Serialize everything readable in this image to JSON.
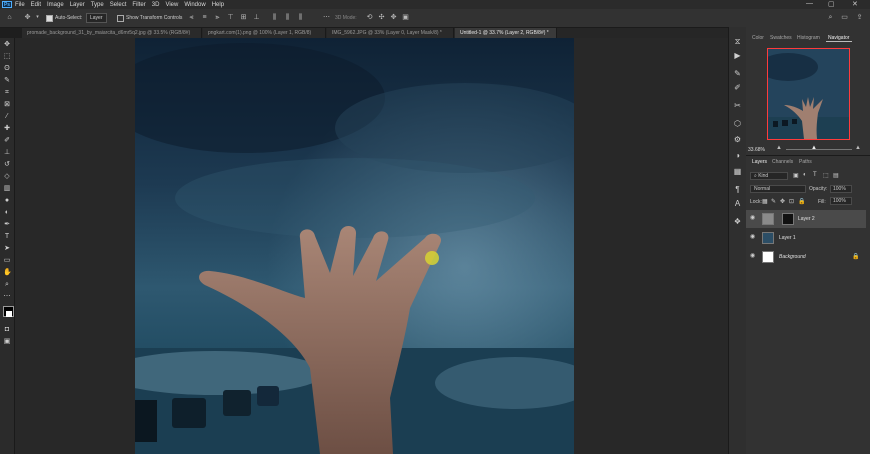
{
  "menubar": {
    "logo": "Ps",
    "items": [
      "File",
      "Edit",
      "Image",
      "Layer",
      "Type",
      "Select",
      "Filter",
      "3D",
      "View",
      "Window",
      "Help"
    ]
  },
  "options": {
    "auto_select_label": "Auto-Select:",
    "layer_select": "Layer",
    "transform_controls": "Show Transform Controls",
    "mode_3d": "3D Mode:"
  },
  "tabs": [
    "promade_background_31_by_maiarcita_d6mr5q2.jpg @ 33.5% (RGB/8#)",
    "pngkart.com(1).png @ 100% (Layer 1, RGB/8)",
    "IMG_5962.JPG @ 33% (Layer 0, Layer Mask/8) *",
    "Untitled-1 @ 33.7% (Layer 2, RGB/8#) *"
  ],
  "panel_tabs_top": [
    "Color",
    "Swatches",
    "Histogram",
    "Navigator"
  ],
  "navigator": {
    "zoom": "33.68%"
  },
  "panel_tabs_layers": [
    "Layers",
    "Channels",
    "Paths"
  ],
  "layers_panel": {
    "kind_filter": "Kind",
    "blend_mode": "Normal",
    "opacity_label": "Opacity:",
    "opacity_value": "100%",
    "lock_label": "Lock:",
    "fill_label": "Fill:",
    "fill_value": "100%"
  },
  "layers": [
    {
      "name": "Layer 2",
      "selected": true
    },
    {
      "name": "Layer 1",
      "selected": false
    },
    {
      "name": "Background",
      "selected": false
    }
  ],
  "colors": {
    "accent_red": "#ff3b3b",
    "panel": "#323232",
    "menubar": "#2b2b2b"
  }
}
